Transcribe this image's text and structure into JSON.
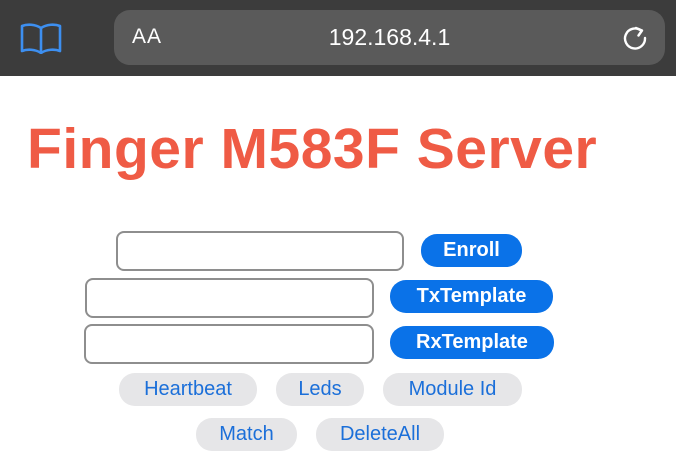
{
  "browser": {
    "reader_icon": "book-icon",
    "text_size_label": "AA",
    "address": "192.168.4.1",
    "reload_icon": "reload-icon"
  },
  "page": {
    "title": "Finger M583F Server",
    "title_color": "#ef5b45"
  },
  "rows": {
    "enroll": {
      "input_value": "",
      "button_label": "Enroll"
    },
    "tx_template": {
      "input_value": "",
      "button_label": "TxTemplate"
    },
    "rx_template": {
      "input_value": "",
      "button_label": "RxTemplate"
    }
  },
  "actions": {
    "heartbeat": "Heartbeat",
    "leds": "Leds",
    "module_id": "Module Id",
    "match": "Match",
    "delete_all": "DeleteAll"
  },
  "colors": {
    "primary_button": "#0a72e8",
    "secondary_button_bg": "#e6e6e8",
    "secondary_button_text": "#1b6fd9",
    "toolbar": "#3c3c3c"
  }
}
